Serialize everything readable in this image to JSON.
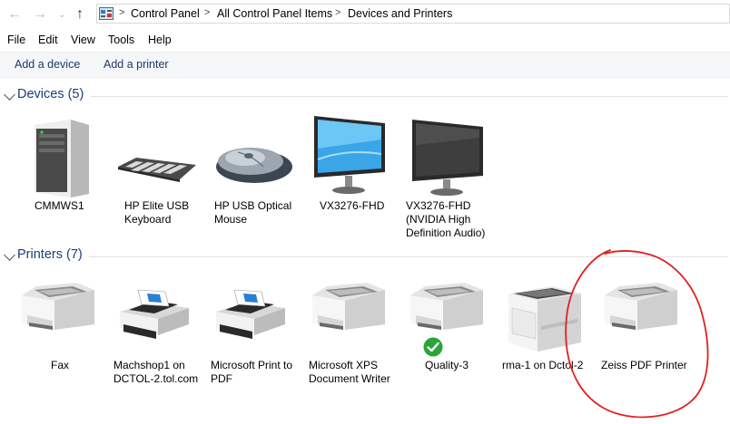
{
  "breadcrumb": {
    "items": [
      "Control Panel",
      "All Control Panel Items",
      "Devices and Printers"
    ]
  },
  "menu": {
    "items": [
      "File",
      "Edit",
      "View",
      "Tools",
      "Help"
    ]
  },
  "commands": {
    "add_device": "Add a device",
    "add_printer": "Add a printer"
  },
  "devices": {
    "title": "Devices (5)",
    "items": [
      {
        "label": "CMMWS1",
        "icon": "tower-pc-icon"
      },
      {
        "label": "HP Elite USB Keyboard",
        "line1": "HP Elite USB",
        "line2": "Keyboard",
        "icon": "keyboard-icon"
      },
      {
        "label": "HP USB Optical Mouse",
        "line1": "HP USB Optical",
        "line2": "Mouse",
        "icon": "mouse-icon"
      },
      {
        "label": "VX3276-FHD",
        "icon": "monitor-icon"
      },
      {
        "label": "VX3276-FHD (NVIDIA High Definition Audio)",
        "line1": "VX3276-FHD",
        "line2": "(NVIDIA High",
        "line3": "Definition Audio)",
        "icon": "monitor-dark-icon"
      }
    ]
  },
  "printers": {
    "title": "Printers (7)",
    "items": [
      {
        "label": "Fax",
        "icon": "printer-icon"
      },
      {
        "label": "Machshop1 on DCTOL-2.tol.com",
        "line1": "Machshop1 on",
        "line2": "DCTOL-2.tol.com",
        "icon": "print-device-icon"
      },
      {
        "label": "Microsoft Print to PDF",
        "line1": "Microsoft Print to",
        "line2": "PDF",
        "icon": "print-device-icon"
      },
      {
        "label": "Microsoft XPS Document Writer",
        "line1": "Microsoft XPS",
        "line2": "Document Writer",
        "icon": "printer-icon"
      },
      {
        "label": "Quality-3",
        "icon": "printer-icon",
        "default": true
      },
      {
        "label": "rma-1 on Dctol-2",
        "icon": "laser-printer-icon"
      },
      {
        "label": "Zeiss PDF Printer",
        "icon": "printer-icon"
      }
    ]
  },
  "colors": {
    "accent": "#1e3d78",
    "annotation": "#e02020",
    "default_check": "#2aa53a"
  }
}
